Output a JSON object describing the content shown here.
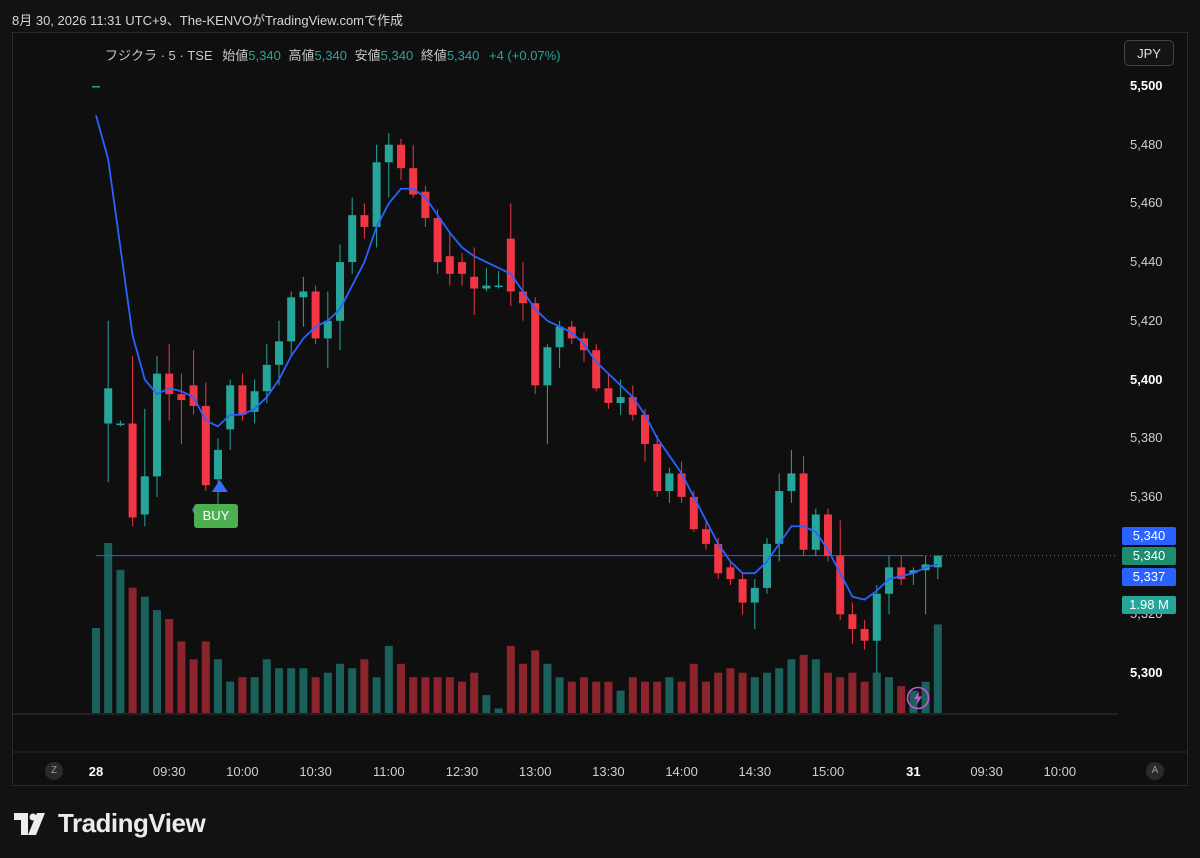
{
  "header": {
    "text": "8月 30, 2026 11:31 UTC+9、The-KENVOがTradingView.comで作成"
  },
  "legend": {
    "symbol": "フジクラ · 5 · TSE",
    "open_label": "始値",
    "open": "5,340",
    "high_label": "高値",
    "high": "5,340",
    "low_label": "安値",
    "low": "5,340",
    "close_label": "終値",
    "close": "5,340",
    "change": "+4 (+0.07%)"
  },
  "currency": "JPY",
  "price_tags": {
    "last_blue": "5,340",
    "last_green": "5,340",
    "ma": "5,337",
    "volume": "1.98 M"
  },
  "buy_label": "BUY",
  "corner": {
    "left": "Z",
    "right": "A"
  },
  "brand": "TradingView",
  "colors": {
    "up": "#26a69a",
    "down": "#f23645",
    "ma": "#2962ff",
    "buy": "#4caf50",
    "background": "#0f0f0f"
  },
  "chart_data": {
    "type": "candlestick",
    "title": "フジクラ · 5 · TSE",
    "interval": "5",
    "ylim": [
      5285,
      5505
    ],
    "y_ticks": [
      "5,300",
      "5,320",
      "5,340",
      "5,360",
      "5,380",
      "5,400",
      "5,420",
      "5,440",
      "5,460",
      "5,480",
      "5,500"
    ],
    "x_ticks": [
      {
        "label": "28",
        "bar": 0
      },
      {
        "label": "09:30",
        "bar": 6
      },
      {
        "label": "10:00",
        "bar": 12
      },
      {
        "label": "10:30",
        "bar": 18
      },
      {
        "label": "11:00",
        "bar": 24
      },
      {
        "label": "12:30",
        "bar": 30
      },
      {
        "label": "13:00",
        "bar": 36
      },
      {
        "label": "13:30",
        "bar": 42
      },
      {
        "label": "14:00",
        "bar": 48
      },
      {
        "label": "14:30",
        "bar": 54
      },
      {
        "label": "15:00",
        "bar": 60
      },
      {
        "label": "31",
        "bar": 67
      },
      {
        "label": "09:30",
        "bar": 73
      },
      {
        "label": "10:00",
        "bar": 79
      }
    ],
    "candles": [
      {
        "o": 5500,
        "h": 5500,
        "l": 5500,
        "c": 5500,
        "v": 1.9
      },
      {
        "o": 5385,
        "h": 5420,
        "l": 5365,
        "c": 5397,
        "v": 3.8
      },
      {
        "o": 5385,
        "h": 5386,
        "l": 5384,
        "c": 5385,
        "v": 3.2
      },
      {
        "o": 5385,
        "h": 5408,
        "l": 5350,
        "c": 5353,
        "v": 2.8
      },
      {
        "o": 5354,
        "h": 5390,
        "l": 5350,
        "c": 5367,
        "v": 2.6
      },
      {
        "o": 5367,
        "h": 5408,
        "l": 5360,
        "c": 5402,
        "v": 2.3
      },
      {
        "o": 5402,
        "h": 5412,
        "l": 5386,
        "c": 5395,
        "v": 2.1
      },
      {
        "o": 5395,
        "h": 5402,
        "l": 5378,
        "c": 5393,
        "v": 1.6
      },
      {
        "o": 5398,
        "h": 5410,
        "l": 5388,
        "c": 5391,
        "v": 1.2
      },
      {
        "o": 5391,
        "h": 5399,
        "l": 5362,
        "c": 5364,
        "v": 1.6
      },
      {
        "o": 5366,
        "h": 5380,
        "l": 5356,
        "c": 5376,
        "v": 1.2
      },
      {
        "o": 5383,
        "h": 5400,
        "l": 5376,
        "c": 5398,
        "v": 0.7
      },
      {
        "o": 5398,
        "h": 5402,
        "l": 5386,
        "c": 5388,
        "v": 0.8
      },
      {
        "o": 5389,
        "h": 5400,
        "l": 5385,
        "c": 5396,
        "v": 0.8
      },
      {
        "o": 5396,
        "h": 5412,
        "l": 5392,
        "c": 5405,
        "v": 1.2
      },
      {
        "o": 5405,
        "h": 5420,
        "l": 5398,
        "c": 5413,
        "v": 1.0
      },
      {
        "o": 5413,
        "h": 5430,
        "l": 5408,
        "c": 5428,
        "v": 1.0
      },
      {
        "o": 5428,
        "h": 5435,
        "l": 5418,
        "c": 5430,
        "v": 1.0
      },
      {
        "o": 5430,
        "h": 5432,
        "l": 5412,
        "c": 5414,
        "v": 0.8
      },
      {
        "o": 5414,
        "h": 5430,
        "l": 5404,
        "c": 5420,
        "v": 0.9
      },
      {
        "o": 5420,
        "h": 5446,
        "l": 5410,
        "c": 5440,
        "v": 1.1
      },
      {
        "o": 5440,
        "h": 5462,
        "l": 5436,
        "c": 5456,
        "v": 1.0
      },
      {
        "o": 5456,
        "h": 5460,
        "l": 5448,
        "c": 5452,
        "v": 1.2
      },
      {
        "o": 5452,
        "h": 5480,
        "l": 5445,
        "c": 5474,
        "v": 0.8
      },
      {
        "o": 5474,
        "h": 5484,
        "l": 5462,
        "c": 5480,
        "v": 1.5
      },
      {
        "o": 5480,
        "h": 5482,
        "l": 5468,
        "c": 5472,
        "v": 1.1
      },
      {
        "o": 5472,
        "h": 5480,
        "l": 5462,
        "c": 5463,
        "v": 0.8
      },
      {
        "o": 5464,
        "h": 5466,
        "l": 5452,
        "c": 5455,
        "v": 0.8
      },
      {
        "o": 5455,
        "h": 5458,
        "l": 5436,
        "c": 5440,
        "v": 0.8
      },
      {
        "o": 5442,
        "h": 5450,
        "l": 5432,
        "c": 5436,
        "v": 0.8
      },
      {
        "o": 5440,
        "h": 5443,
        "l": 5432,
        "c": 5436,
        "v": 0.7
      },
      {
        "o": 5435,
        "h": 5445,
        "l": 5422,
        "c": 5431,
        "v": 0.9
      },
      {
        "o": 5431,
        "h": 5438,
        "l": 5430,
        "c": 5432,
        "v": 0.4
      },
      {
        "o": 5432,
        "h": 5437,
        "l": 5431,
        "c": 5432,
        "v": 0.1
      },
      {
        "o": 5448,
        "h": 5460,
        "l": 5425,
        "c": 5430,
        "v": 1.5
      },
      {
        "o": 5430,
        "h": 5440,
        "l": 5420,
        "c": 5426,
        "v": 1.1
      },
      {
        "o": 5426,
        "h": 5428,
        "l": 5395,
        "c": 5398,
        "v": 1.4
      },
      {
        "o": 5398,
        "h": 5412,
        "l": 5378,
        "c": 5411,
        "v": 1.1
      },
      {
        "o": 5411,
        "h": 5420,
        "l": 5404,
        "c": 5418,
        "v": 0.8
      },
      {
        "o": 5418,
        "h": 5420,
        "l": 5412,
        "c": 5414,
        "v": 0.7
      },
      {
        "o": 5414,
        "h": 5416,
        "l": 5406,
        "c": 5410,
        "v": 0.8
      },
      {
        "o": 5410,
        "h": 5412,
        "l": 5396,
        "c": 5397,
        "v": 0.7
      },
      {
        "o": 5397,
        "h": 5402,
        "l": 5390,
        "c": 5392,
        "v": 0.7
      },
      {
        "o": 5392,
        "h": 5400,
        "l": 5388,
        "c": 5394,
        "v": 0.5
      },
      {
        "o": 5394,
        "h": 5398,
        "l": 5386,
        "c": 5388,
        "v": 0.8
      },
      {
        "o": 5388,
        "h": 5390,
        "l": 5372,
        "c": 5378,
        "v": 0.7
      },
      {
        "o": 5378,
        "h": 5381,
        "l": 5360,
        "c": 5362,
        "v": 0.7
      },
      {
        "o": 5362,
        "h": 5370,
        "l": 5358,
        "c": 5368,
        "v": 0.8
      },
      {
        "o": 5368,
        "h": 5372,
        "l": 5358,
        "c": 5360,
        "v": 0.7
      },
      {
        "o": 5360,
        "h": 5362,
        "l": 5348,
        "c": 5349,
        "v": 1.1
      },
      {
        "o": 5349,
        "h": 5352,
        "l": 5342,
        "c": 5344,
        "v": 0.7
      },
      {
        "o": 5344,
        "h": 5346,
        "l": 5332,
        "c": 5334,
        "v": 0.9
      },
      {
        "o": 5336,
        "h": 5338,
        "l": 5330,
        "c": 5332,
        "v": 1.0
      },
      {
        "o": 5332,
        "h": 5334,
        "l": 5320,
        "c": 5324,
        "v": 0.9
      },
      {
        "o": 5324,
        "h": 5332,
        "l": 5315,
        "c": 5329,
        "v": 0.8
      },
      {
        "o": 5329,
        "h": 5346,
        "l": 5327,
        "c": 5344,
        "v": 0.9
      },
      {
        "o": 5344,
        "h": 5368,
        "l": 5338,
        "c": 5362,
        "v": 1.0
      },
      {
        "o": 5362,
        "h": 5376,
        "l": 5358,
        "c": 5368,
        "v": 1.2
      },
      {
        "o": 5368,
        "h": 5374,
        "l": 5340,
        "c": 5342,
        "v": 1.3
      },
      {
        "o": 5342,
        "h": 5356,
        "l": 5340,
        "c": 5354,
        "v": 1.2
      },
      {
        "o": 5354,
        "h": 5356,
        "l": 5338,
        "c": 5340,
        "v": 0.9
      },
      {
        "o": 5340,
        "h": 5352,
        "l": 5318,
        "c": 5320,
        "v": 0.8
      },
      {
        "o": 5320,
        "h": 5324,
        "l": 5310,
        "c": 5315,
        "v": 0.9
      },
      {
        "o": 5315,
        "h": 5318,
        "l": 5308,
        "c": 5311,
        "v": 0.7
      },
      {
        "o": 5311,
        "h": 5330,
        "l": 5300,
        "c": 5327,
        "v": 0.9
      },
      {
        "o": 5327,
        "h": 5340,
        "l": 5320,
        "c": 5336,
        "v": 0.8
      },
      {
        "o": 5336,
        "h": 5340,
        "l": 5330,
        "c": 5332,
        "v": 0.6
      },
      {
        "o": 5334,
        "h": 5336,
        "l": 5330,
        "c": 5335,
        "v": 0.5
      },
      {
        "o": 5335,
        "h": 5340,
        "l": 5320,
        "c": 5337,
        "v": 0.7
      },
      {
        "o": 5336,
        "h": 5340,
        "l": 5332,
        "c": 5340,
        "v": 1.98
      }
    ],
    "ma": [
      5490,
      5475,
      5445,
      5415,
      5400,
      5395,
      5397,
      5396,
      5394,
      5386,
      5384,
      5388,
      5388,
      5390,
      5394,
      5400,
      5408,
      5414,
      5418,
      5420,
      5424,
      5432,
      5440,
      5452,
      5460,
      5465,
      5465,
      5462,
      5456,
      5450,
      5445,
      5442,
      5440,
      5438,
      5436,
      5430,
      5424,
      5420,
      5418,
      5416,
      5412,
      5406,
      5402,
      5398,
      5394,
      5388,
      5380,
      5374,
      5368,
      5360,
      5352,
      5344,
      5338,
      5334,
      5334,
      5338,
      5344,
      5350,
      5350,
      5348,
      5342,
      5334,
      5326,
      5325,
      5328,
      5332,
      5333,
      5334,
      5336,
      5337
    ],
    "price_line": 5340,
    "buy_marker_bar": 9,
    "volume_last": "1.98 M"
  }
}
